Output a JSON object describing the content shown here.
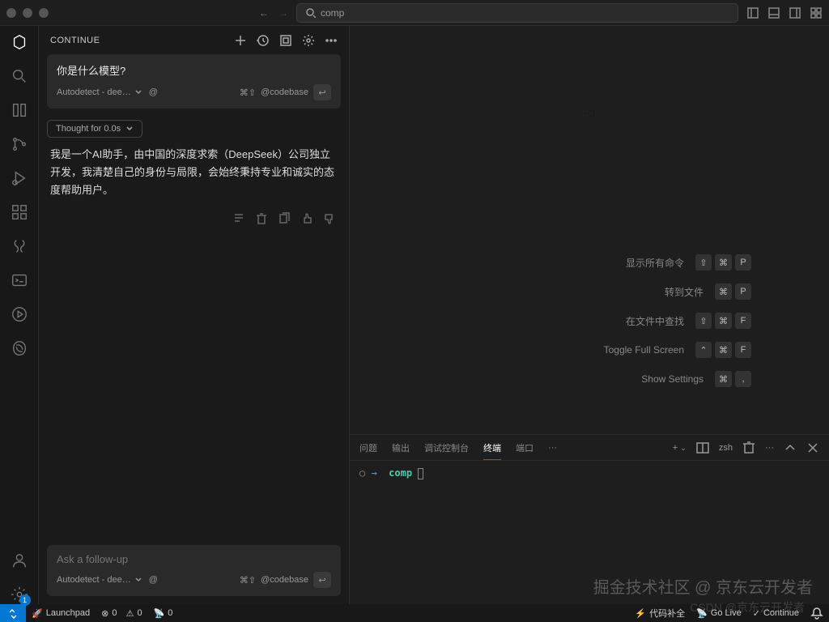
{
  "titlebar": {
    "search_prefix": "comp"
  },
  "sidebar": {
    "title": "CONTINUE",
    "user_msg": {
      "question": "你是什么模型?",
      "model": "Autodetect - dee…",
      "shortcut": "⌘⇧",
      "context": "@codebase"
    },
    "thought": "Thought for 0.0s",
    "response": "我是一个AI助手，由中国的深度求索（DeepSeek）公司独立开发，我清楚自己的身份与局限，会始终秉持专业和诚实的态度帮助用户。",
    "followup": {
      "placeholder": "Ask a follow-up",
      "model": "Autodetect - dee…",
      "shortcut": "⌘⇧",
      "context": "@codebase"
    }
  },
  "welcome": {
    "commands": [
      {
        "label": "显示所有命令",
        "keys": [
          "⇧",
          "⌘",
          "P"
        ]
      },
      {
        "label": "转到文件",
        "keys": [
          "⌘",
          "P"
        ]
      },
      {
        "label": "在文件中查找",
        "keys": [
          "⇧",
          "⌘",
          "F"
        ]
      },
      {
        "label": "Toggle Full Screen",
        "keys": [
          "⌃",
          "⌘",
          "F"
        ]
      },
      {
        "label": "Show Settings",
        "keys": [
          "⌘",
          ","
        ]
      }
    ]
  },
  "panel": {
    "tabs": [
      "问题",
      "输出",
      "调试控制台",
      "终端",
      "端口"
    ],
    "active_tab": "终端",
    "shell": "zsh",
    "terminal": {
      "symbol": "○ →",
      "command": "comp"
    }
  },
  "status": {
    "launchpad": "Launchpad",
    "errors": "0",
    "warnings": "0",
    "ports": "0",
    "code_complete": "代码补全",
    "golive": "Go Live",
    "continue": "Continue"
  },
  "watermark": "掘金技术社区 @ 京东云开发者",
  "watermark2": "CSDN @京东云开发者"
}
